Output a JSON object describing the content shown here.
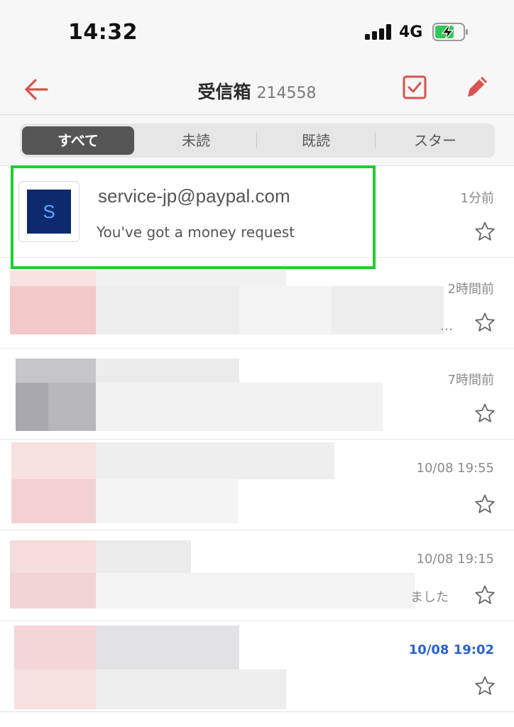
{
  "status_bar": {
    "time": "14:32",
    "network": "4G"
  },
  "nav": {
    "title": "受信箱",
    "count": "214558"
  },
  "filters": {
    "all": "すべて",
    "unread": "未読",
    "read": "既読",
    "starred": "スター"
  },
  "mails": [
    {
      "sender": "service-jp@paypal.com",
      "avatar_letter": "S",
      "subject": "You've got a money request",
      "time": "1分前"
    },
    {
      "time": "2時間前",
      "trail": "…"
    },
    {
      "time": "7時間前"
    },
    {
      "time": "10/08 19:55"
    },
    {
      "time": "10/08 19:15",
      "trail": "ました"
    },
    {
      "time": "10/08 19:02",
      "unread": true
    }
  ],
  "colors": {
    "accent": "#d9534f",
    "highlight": "#22cc33",
    "unread_time": "#2a62c9",
    "avatar_bg": "#0e2a6e"
  }
}
